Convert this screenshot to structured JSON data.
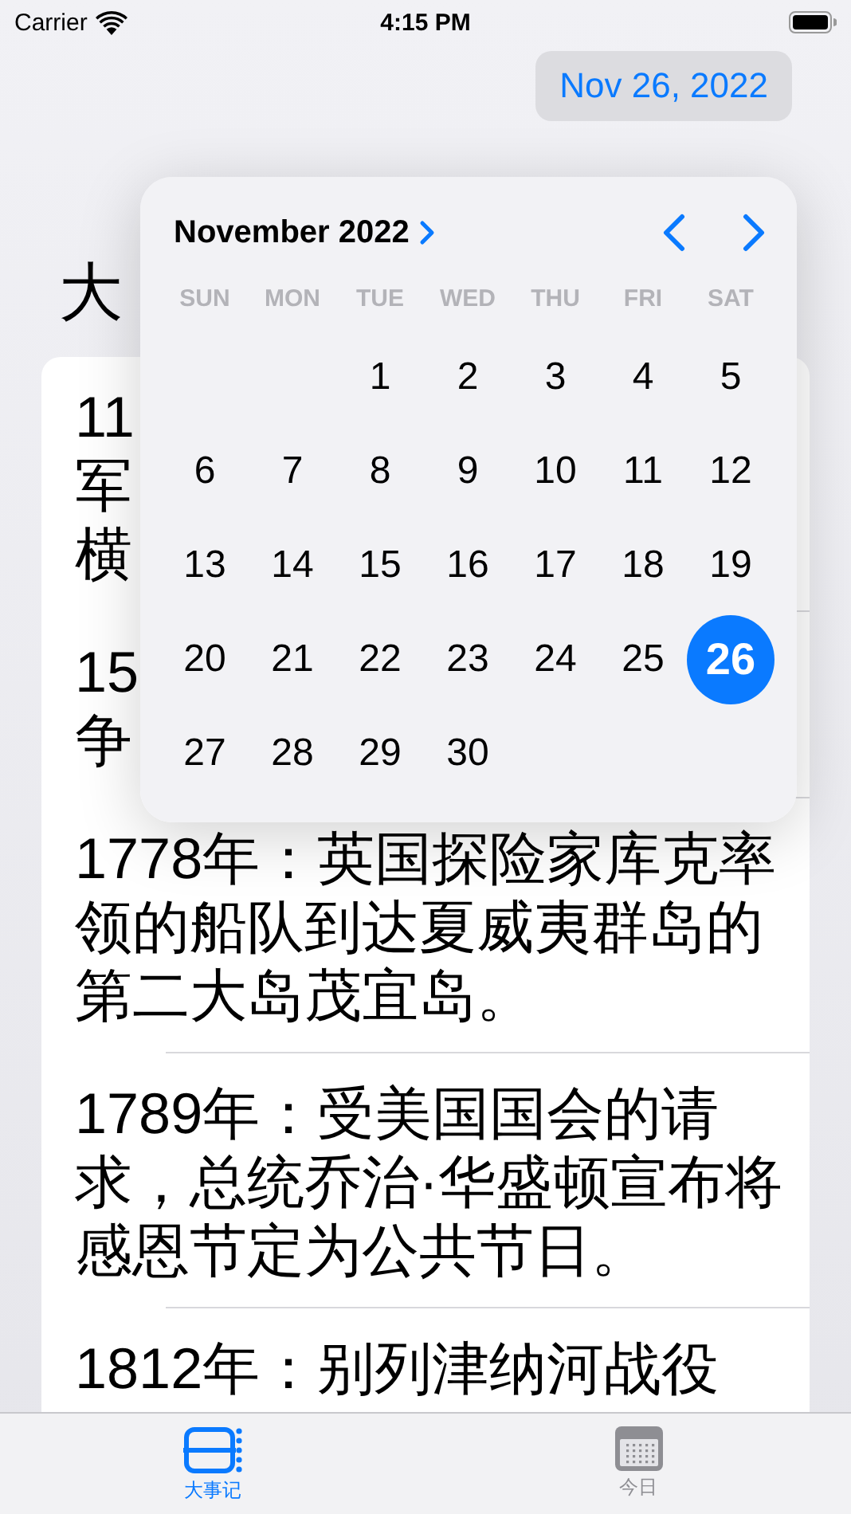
{
  "status_bar": {
    "carrier": "Carrier",
    "time": "4:15 PM"
  },
  "date_button": {
    "label": "Nov 26, 2022"
  },
  "title": "大",
  "events": [
    {
      "lines": [
        "11",
        "军",
        "横"
      ]
    },
    {
      "lines": [
        "15",
        "争"
      ]
    },
    {
      "lines": [
        "1778年：英国探险家库克率",
        "领的船队到达夏威夷群岛的",
        "第二大岛茂宜岛。"
      ]
    },
    {
      "lines": [
        "1789年：受美国国会的请",
        "求，总统乔治·华盛顿宣布将",
        "感恩节定为公共节日。"
      ]
    },
    {
      "lines": [
        "1812年：别列津纳河战役"
      ]
    }
  ],
  "date_picker": {
    "month_title": "November 2022",
    "weekdays": [
      "SUN",
      "MON",
      "TUE",
      "WED",
      "THU",
      "FRI",
      "SAT"
    ],
    "weeks": [
      [
        {
          "label": "1",
          "selected": false
        },
        {
          "label": "2",
          "selected": false
        },
        {
          "label": "3",
          "selected": false
        },
        {
          "label": "4",
          "selected": false
        },
        {
          "label": "5",
          "selected": false
        }
      ],
      [
        {
          "label": "6",
          "selected": false
        },
        {
          "label": "7",
          "selected": false
        },
        {
          "label": "8",
          "selected": false
        },
        {
          "label": "9",
          "selected": false
        },
        {
          "label": "10",
          "selected": false
        },
        {
          "label": "11",
          "selected": false
        },
        {
          "label": "12",
          "selected": false
        }
      ],
      [
        {
          "label": "13",
          "selected": false
        },
        {
          "label": "14",
          "selected": false
        },
        {
          "label": "15",
          "selected": false
        },
        {
          "label": "16",
          "selected": false
        },
        {
          "label": "17",
          "selected": false
        },
        {
          "label": "18",
          "selected": false
        },
        {
          "label": "19",
          "selected": false
        }
      ],
      [
        {
          "label": "20",
          "selected": false
        },
        {
          "label": "21",
          "selected": false
        },
        {
          "label": "22",
          "selected": false
        },
        {
          "label": "23",
          "selected": false
        },
        {
          "label": "24",
          "selected": false
        },
        {
          "label": "25",
          "selected": false
        },
        {
          "label": "26",
          "selected": true
        }
      ],
      [
        {
          "label": "27",
          "selected": false
        },
        {
          "label": "28",
          "selected": false
        },
        {
          "label": "29",
          "selected": false
        },
        {
          "label": "30",
          "selected": false
        }
      ]
    ]
  },
  "tabs": [
    {
      "label": "大事记",
      "kind": "events",
      "selected": true
    },
    {
      "label": "今日",
      "kind": "calendar",
      "selected": false
    }
  ]
}
